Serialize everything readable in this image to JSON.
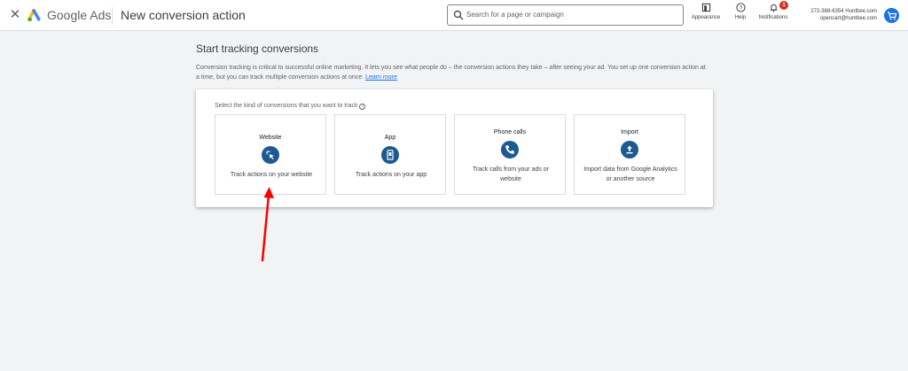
{
  "header": {
    "product_name": "Google Ads",
    "page_title": "New conversion action",
    "search_placeholder": "Search for a page or campaign",
    "tools": {
      "appearance": "Appearance",
      "help": "Help",
      "notifications": "Notifications",
      "notifications_count": "1"
    },
    "account": {
      "line1": "272-388-6354 Huntbee.com",
      "line2": "opencart@huntbee.com"
    }
  },
  "main": {
    "title": "Start tracking conversions",
    "intro": "Conversion tracking is critical to successful online marketing. It lets you see what people do – the conversion actions they take – after seeing your ad. You set up one conversion action at a time, but you can track multiple conversion actions at once.",
    "learn_more": "Learn more",
    "prompt": "Select the kind of conversions that you want to track"
  },
  "cards": [
    {
      "title": "Website",
      "description": "Track actions on your website",
      "icon": "cursor-click-icon"
    },
    {
      "title": "App",
      "description": "Track actions on your app",
      "icon": "phone-app-icon"
    },
    {
      "title": "Phone calls",
      "description": "Track calls from your ads or website",
      "icon": "phone-call-icon"
    },
    {
      "title": "Import",
      "description": "Import data from Google Analytics or another source",
      "icon": "upload-icon"
    }
  ],
  "colors": {
    "accent": "#1a73e8",
    "icon_circle": "#1e5a92",
    "annotation_arrow": "#ff0000"
  }
}
